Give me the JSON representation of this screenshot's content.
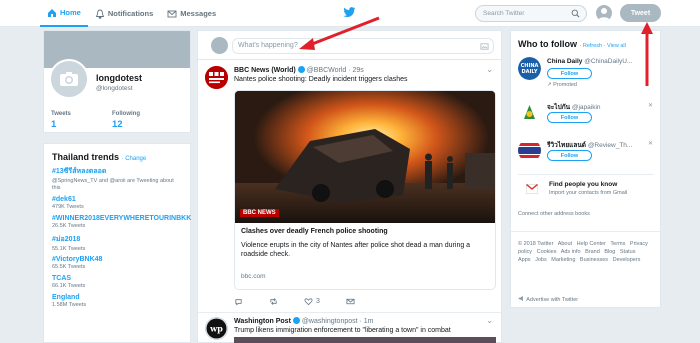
{
  "nav": {
    "home": "Home",
    "notifications": "Notifications",
    "messages": "Messages"
  },
  "search": {
    "placeholder": "Search Twitter"
  },
  "tweet_button": "Tweet",
  "profile": {
    "name": "longdotest",
    "handle": "@longdotest",
    "tweets_label": "Tweets",
    "tweets_value": "1",
    "following_label": "Following",
    "following_value": "12"
  },
  "trends": {
    "title": "Thailand trends",
    "change": "· Change",
    "items": [
      {
        "name": "#13ซีรีส์หลงตลอด",
        "sub": "@SpringNews_TV and @aroii are Tweeting about this"
      },
      {
        "name": "#dek61",
        "sub": "479K Tweets"
      },
      {
        "name": "#WINNER2018EVERYWHERETOURINBKK",
        "sub": "26.5K Tweets"
      },
      {
        "name": "#ม่อ2018",
        "sub": "55.1K Tweets"
      },
      {
        "name": "#VictoryBNK48",
        "sub": "65.5K Tweets"
      },
      {
        "name": "TCAS",
        "sub": "66.1K Tweets"
      },
      {
        "name": "England",
        "sub": "1.58M Tweets"
      }
    ]
  },
  "composer": {
    "placeholder": "What's happening?"
  },
  "tweets": [
    {
      "name": "BBC News (World)",
      "handle": "@BBCWorld · 29s",
      "text": "Nantes police shooting: Deadly incident triggers clashes",
      "card_title": "Clashes over deadly French police shooting",
      "card_desc": "Violence erupts in the city of Nantes after police shot dead a man during a roadside check.",
      "card_url": "bbc.com",
      "likes": "3",
      "avatar_text": "BBC NEWS WORLD",
      "image_logo": "BBC NEWS"
    },
    {
      "name": "Washington Post",
      "handle": "@washingtonpost · 1m",
      "text": "Trump likens immigration enforcement to \"liberating a town\" in combat",
      "avatar_text": "wp"
    }
  ],
  "who_to_follow": {
    "title": "Who to follow",
    "links": "· Refresh · View all",
    "follow_label": "Follow",
    "suggestions": [
      {
        "name": "China Daily",
        "handle": "@ChinaDailyU...",
        "promoted": "Promoted",
        "avatar_text": "CHINA DAILY"
      },
      {
        "name": "จะไปกัน",
        "handle": "@japaikin"
      },
      {
        "name": "รีวิวไทยแลนด์",
        "handle": "@Review_Th..."
      }
    ],
    "find_title": "Find people you know",
    "find_sub": "Import your contacts from Gmail",
    "connect": "Connect other address books"
  },
  "footer": {
    "links": [
      "© 2018 Twitter",
      "About",
      "Help Center",
      "Terms",
      "Privacy policy",
      "Cookies",
      "Ads info",
      "Brand",
      "Blog",
      "Status",
      "Apps",
      "Jobs",
      "Marketing",
      "Businesses",
      "Developers"
    ],
    "advertise": "Advertise with Twitter"
  },
  "colors": {
    "accent": "#1da1f2",
    "annotation": "#e0202a"
  }
}
